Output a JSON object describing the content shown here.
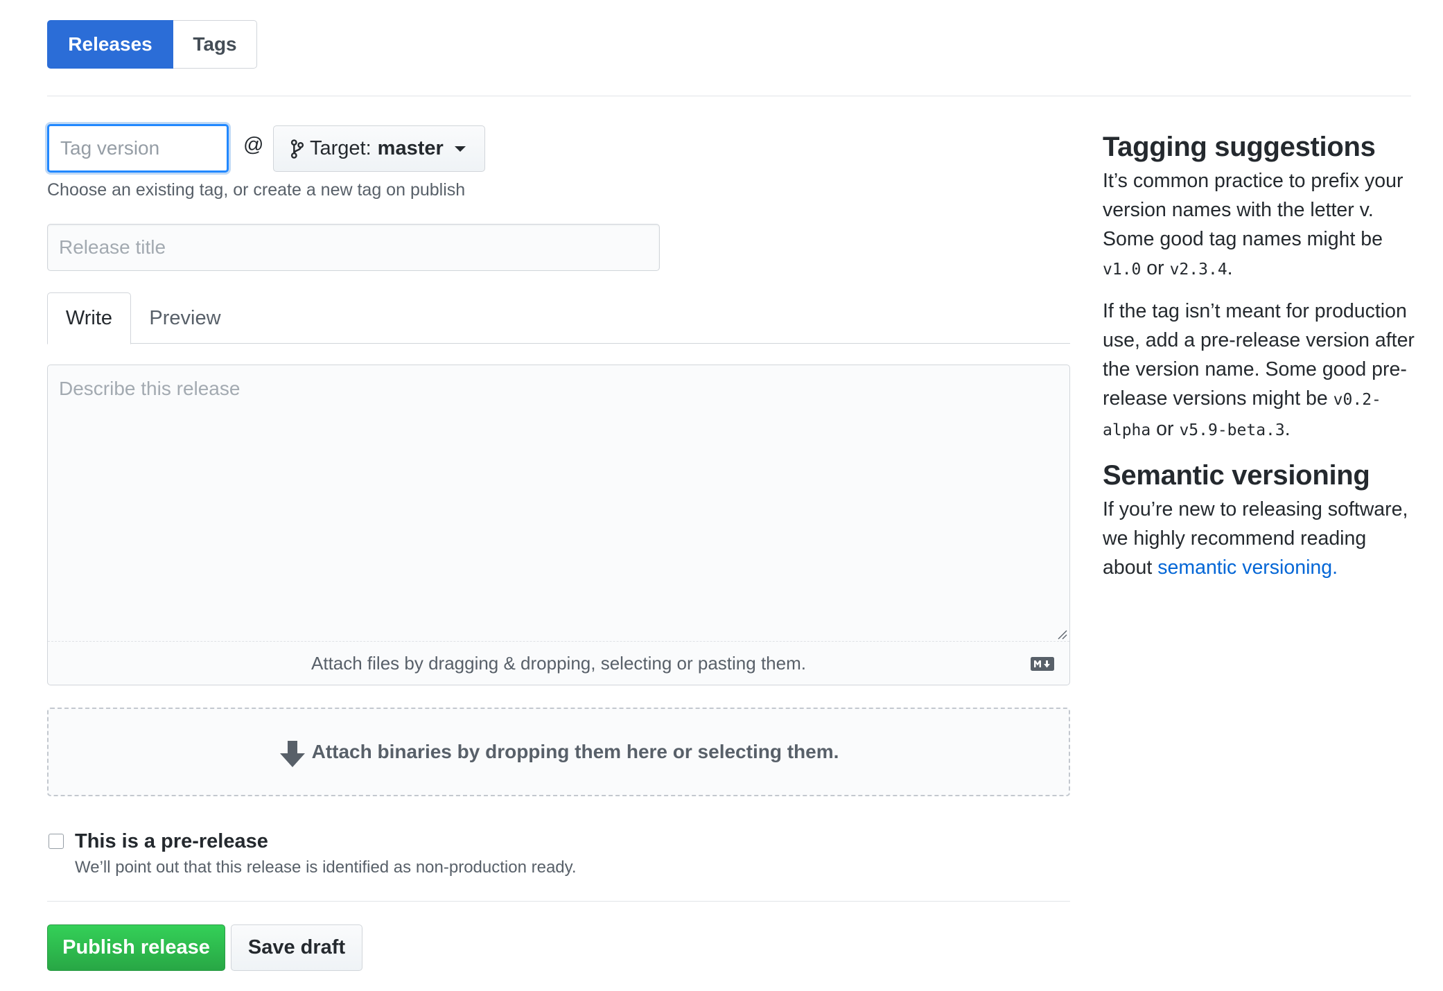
{
  "subnav": {
    "releases_label": "Releases",
    "tags_label": "Tags"
  },
  "tag": {
    "placeholder": "Tag version",
    "at": "@",
    "target_label": "Target:",
    "target_value": "master",
    "hint": "Choose an existing tag, or create a new tag on publish"
  },
  "release_title": {
    "placeholder": "Release title"
  },
  "editor": {
    "write_tab": "Write",
    "preview_tab": "Preview",
    "placeholder": "Describe this release",
    "attach_text": "Attach files by dragging & dropping, selecting or pasting them."
  },
  "binaries": {
    "text": "Attach binaries by dropping them here or selecting them."
  },
  "prerelease": {
    "label": "This is a pre-release",
    "note": "We’ll point out that this release is identified as non-production ready."
  },
  "actions": {
    "publish": "Publish release",
    "save_draft": "Save draft"
  },
  "sidebar": {
    "tagging_heading": "Tagging suggestions",
    "tagging_p1_a": "It’s common practice to prefix your version names with the letter ",
    "tagging_p1_code_v": "v",
    "tagging_p1_b": ". Some good tag names might be ",
    "tagging_p1_code1": "v1.0",
    "tagging_p1_or": " or ",
    "tagging_p1_code2": "v2.3.4",
    "tagging_p1_end": ".",
    "tagging_p2_a": "If the tag isn’t meant for production use, add a pre-release version after the version name. Some good pre-release versions might be ",
    "tagging_p2_code1": "v0.2-alpha",
    "tagging_p2_or": " or ",
    "tagging_p2_code2": "v5.9-beta.3",
    "tagging_p2_end": ".",
    "semver_heading": "Semantic versioning",
    "semver_p_a": "If you’re new to releasing software, we highly recommend reading about ",
    "semver_link": "semantic versioning."
  },
  "colors": {
    "primary_blue": "#2b6dd7",
    "publish_green": "#28a745",
    "link_blue": "#0366d6",
    "text_muted": "#586069"
  },
  "icons": {
    "target": "git-branch-icon",
    "dropdown": "caret-down-icon",
    "markdown": "markdown-icon",
    "binaries": "arrow-down-icon"
  }
}
